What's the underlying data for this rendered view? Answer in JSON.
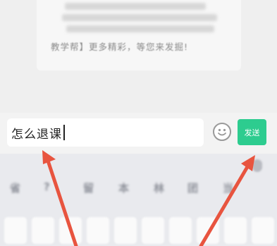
{
  "chat": {
    "message_tail": "教学帮】更多精彩，等您来发掘!"
  },
  "input": {
    "value": "怎么退课"
  },
  "toolbar": {
    "emoji_icon": "smiley-face-icon",
    "send_label": "发送"
  },
  "keyboard": {
    "candidates": [
      "省",
      "?",
      "留",
      "本",
      "林",
      "团",
      "当"
    ]
  },
  "colors": {
    "send_button": "#2dcc8f",
    "annotation_arrow": "#e8543f"
  }
}
